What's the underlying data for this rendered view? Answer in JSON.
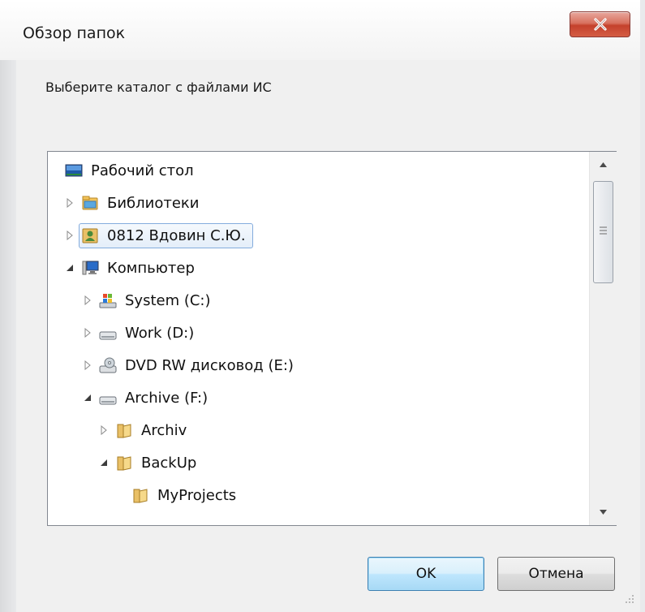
{
  "window": {
    "title": "Обзор папок",
    "close_icon": "close-icon"
  },
  "prompt": "Выберите каталог с файлами ИС",
  "tree": {
    "items": [
      {
        "label": "Рабочий стол",
        "icon": "desktop-icon",
        "expander": "none",
        "level": 0
      },
      {
        "label": "Библиотеки",
        "icon": "libraries-icon",
        "expander": "collapsed",
        "level": 0
      },
      {
        "label": "0812 Вдовин С.Ю.",
        "icon": "user-folder-icon",
        "expander": "collapsed",
        "level": 0,
        "selected": true
      },
      {
        "label": "Компьютер",
        "icon": "computer-icon",
        "expander": "expanded",
        "level": 0
      },
      {
        "label": "System (C:)",
        "icon": "system-drive-icon",
        "expander": "collapsed",
        "level": 1
      },
      {
        "label": "Work (D:)",
        "icon": "drive-icon",
        "expander": "collapsed",
        "level": 1
      },
      {
        "label": "DVD RW дисковод (E:)",
        "icon": "dvd-drive-icon",
        "expander": "collapsed",
        "level": 1
      },
      {
        "label": "Archive (F:)",
        "icon": "drive-icon",
        "expander": "expanded",
        "level": 1
      },
      {
        "label": "Archiv",
        "icon": "folder-icon",
        "expander": "collapsed",
        "level": 2
      },
      {
        "label": "BackUp",
        "icon": "folder-icon",
        "expander": "expanded",
        "level": 2
      },
      {
        "label": "MyProjects",
        "icon": "folder-icon",
        "expander": "none",
        "level": 3
      }
    ]
  },
  "buttons": {
    "ok": "OK",
    "cancel": "Отмена"
  },
  "colors": {
    "selection_border": "#84acdd",
    "default_button": "#a7d9f5",
    "close_button": "#c4412c"
  }
}
